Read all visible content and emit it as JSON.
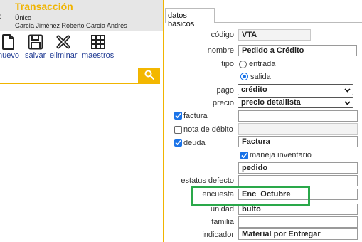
{
  "header": {
    "title": "Transacción",
    "line1": "Único",
    "line2": "García Jiménez Roberto García Andrés"
  },
  "toolbar": {
    "new_label": "nuevo",
    "save_label": "salvar",
    "delete_label": "eliminar",
    "masters_label": "maestros"
  },
  "search": {
    "value": ""
  },
  "tabs": {
    "active": "datos básicos"
  },
  "form": {
    "codigo": {
      "label": "código",
      "value": "VTA"
    },
    "nombre": {
      "label": "nombre",
      "value": "Pedido a Crédito"
    },
    "tipo": {
      "label": "tipo",
      "options": [
        "entrada",
        "salida"
      ],
      "selected": "salida"
    },
    "pago": {
      "label": "pago",
      "value": "crédito"
    },
    "precio": {
      "label": "precio",
      "value": "precio detallista"
    },
    "factura": {
      "label": "factura",
      "checked": true,
      "value": ""
    },
    "nota_debito": {
      "label": "nota de débito",
      "checked": false,
      "value": ""
    },
    "deuda": {
      "label": "deuda",
      "checked": true,
      "value": "Factura"
    },
    "maneja_inventario": {
      "label": "maneja inventario",
      "checked": true,
      "value": "pedido"
    },
    "estatus_defecto": {
      "label": "estatus defecto",
      "value": ""
    },
    "encuesta": {
      "label": "encuesta",
      "value": "Enc  Octubre"
    },
    "unidad": {
      "label": "unidad",
      "value": "bulto"
    },
    "familia": {
      "label": "familia",
      "value": ""
    },
    "indicador": {
      "label": "indicador",
      "value": "Material por Entregar"
    }
  },
  "colors": {
    "accent": "#f0b400",
    "highlight": "#2aa84a",
    "link": "#1f3a93",
    "check": "#1a73e8"
  }
}
